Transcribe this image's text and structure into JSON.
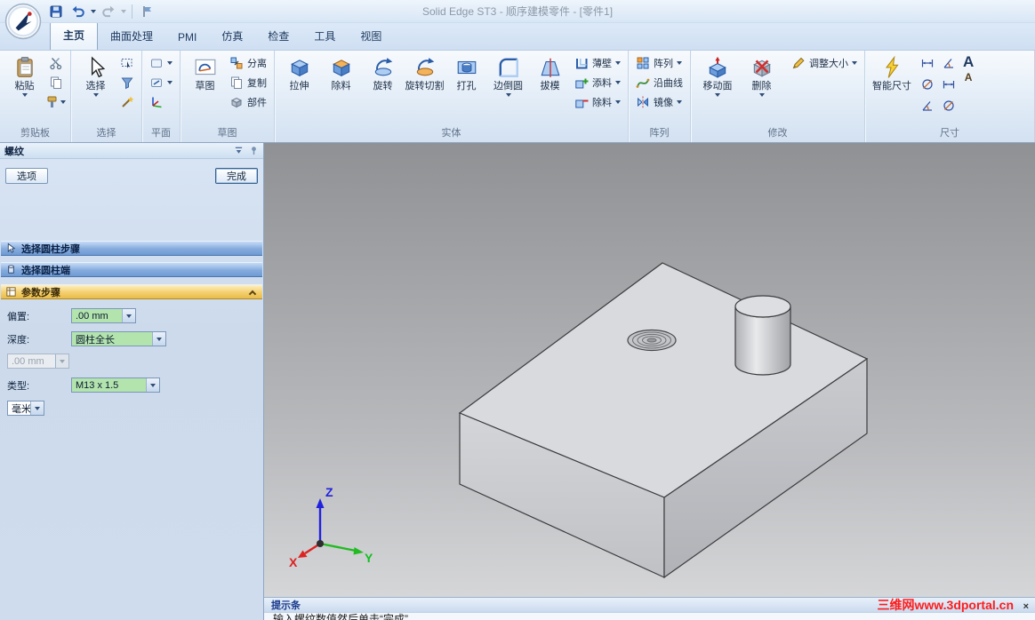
{
  "titlebar": {
    "title": "Solid Edge ST3 - 顺序建模零件 - [零件1]"
  },
  "tabs": [
    {
      "label": "主页",
      "active": true
    },
    {
      "label": "曲面处理"
    },
    {
      "label": "PMI"
    },
    {
      "label": "仿真"
    },
    {
      "label": "检查"
    },
    {
      "label": "工具"
    },
    {
      "label": "视图"
    }
  ],
  "ribbon": {
    "clipboard": {
      "group_label": "剪贴板",
      "paste": "粘贴"
    },
    "select": {
      "group_label": "选择",
      "select": "选择"
    },
    "plane": {
      "group_label": "平面"
    },
    "sketch": {
      "group_label": "草图",
      "sketch": "草图",
      "detach": "分离",
      "copy": "复制",
      "component": "部件"
    },
    "solids": {
      "group_label": "实体",
      "extrude": "拉伸",
      "cut": "除料",
      "revolve": "旋转",
      "revolved_cut": "旋转切割",
      "hole": "打孔",
      "round": "边倒圆",
      "draft": "拔模",
      "thin_wall": "薄壁",
      "add_material": "添料",
      "remove_material": "除料"
    },
    "pattern": {
      "group_label": "阵列",
      "pattern": "阵列",
      "along_curve": "沿曲线",
      "mirror": "镜像"
    },
    "modify": {
      "group_label": "修改",
      "move_face": "移动面",
      "delete": "删除",
      "resize": "调整大小"
    },
    "dimension": {
      "group_label": "尺寸",
      "smart_dimension": "智能尺寸",
      "annotation_a": "A"
    }
  },
  "panel": {
    "title": "螺纹",
    "options_button": "选项",
    "finish_button": "完成",
    "step1": "选择圆柱步骤",
    "step2": "选择圆柱端",
    "step3": "参数步骤",
    "offset_label": "偏置:",
    "offset_value": ".00 mm",
    "depth_label": "深度:",
    "depth_value": "圆柱全长",
    "depth_offset_value": ".00 mm",
    "type_label": "类型:",
    "type_value": "M13 x 1.5",
    "unit_value": "毫米"
  },
  "viewport": {
    "axis_x": "X",
    "axis_y": "Y",
    "axis_z": "Z",
    "watermark": "三维网www.3dportal.cn",
    "watermark_close": "×"
  },
  "prompt": {
    "title": "提示条",
    "message": "输入螺纹数值然后单击“完成”"
  }
}
